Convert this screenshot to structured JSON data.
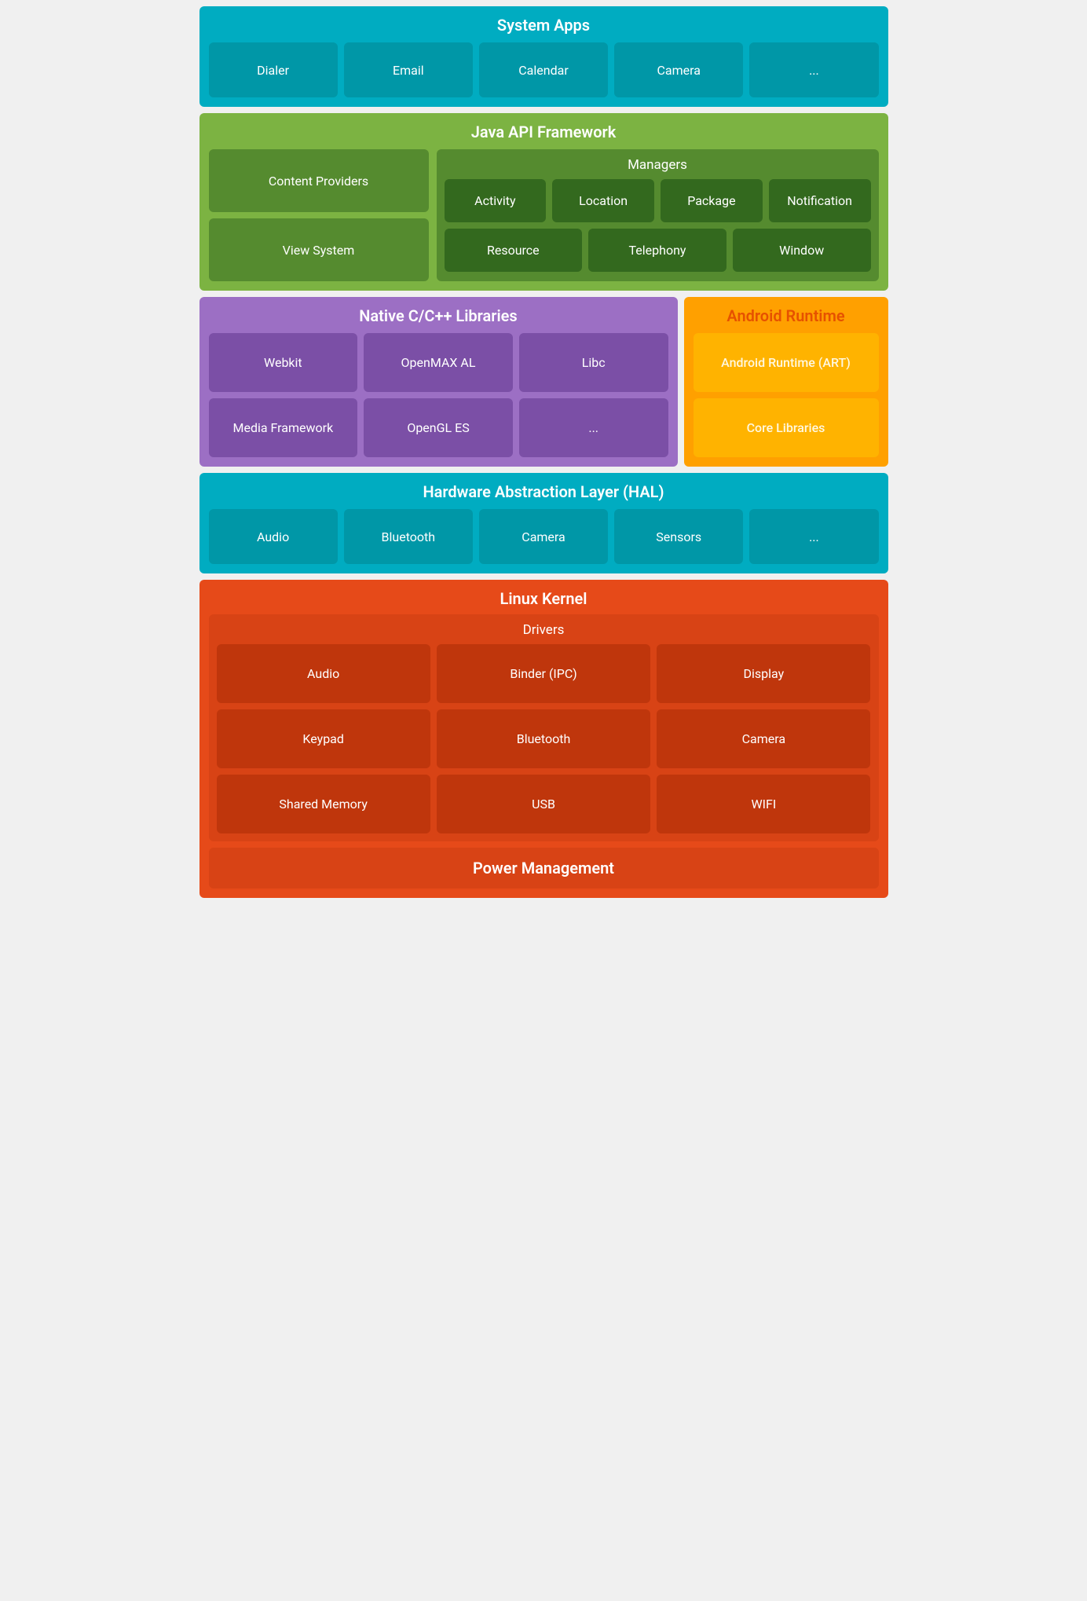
{
  "system_apps": {
    "title": "System Apps",
    "cards": [
      "Dialer",
      "Email",
      "Calendar",
      "Camera",
      "..."
    ]
  },
  "java_api": {
    "title": "Java API Framework",
    "left": {
      "items": [
        "Content Providers",
        "View System"
      ]
    },
    "right": {
      "title": "Managers",
      "rows": [
        [
          "Activity",
          "Location",
          "Package",
          "Notification"
        ],
        [
          "Resource",
          "Telephony",
          "Window"
        ]
      ]
    }
  },
  "native": {
    "title": "Native C/C++ Libraries",
    "rows": [
      [
        "Webkit",
        "OpenMAX AL",
        "Libc"
      ],
      [
        "Media Framework",
        "OpenGL ES",
        "..."
      ]
    ]
  },
  "android_runtime": {
    "title": "Android Runtime",
    "cards": [
      "Android Runtime (ART)",
      "Core Libraries"
    ]
  },
  "hal": {
    "title": "Hardware Abstraction Layer (HAL)",
    "cards": [
      "Audio",
      "Bluetooth",
      "Camera",
      "Sensors",
      "..."
    ]
  },
  "linux": {
    "title": "Linux Kernel",
    "drivers_title": "Drivers",
    "driver_rows": [
      [
        "Audio",
        "Binder (IPC)",
        "Display"
      ],
      [
        "Keypad",
        "Bluetooth",
        "Camera"
      ],
      [
        "Shared Memory",
        "USB",
        "WIFI"
      ]
    ],
    "power_management": "Power Management"
  }
}
